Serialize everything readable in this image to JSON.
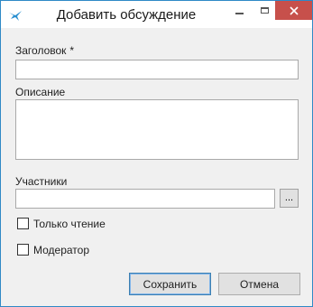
{
  "window": {
    "title": "Добавить обсуждение",
    "controls": {
      "minimize": "minimize-icon",
      "maximize": "maximize-icon",
      "close": "close-icon"
    }
  },
  "form": {
    "title_label": "Заголовок",
    "required_mark": "*",
    "title_value": "",
    "description_label": "Описание",
    "description_value": "",
    "participants_label": "Участники",
    "participants_value": "",
    "browse_label": "...",
    "readonly_label": "Только чтение",
    "readonly_checked": false,
    "moderator_label": "Модератор",
    "moderator_checked": false
  },
  "buttons": {
    "save": "Сохранить",
    "cancel": "Отмена"
  },
  "colors": {
    "accent": "#2f89c6",
    "close": "#c7504b",
    "background": "#f0f0f0"
  }
}
